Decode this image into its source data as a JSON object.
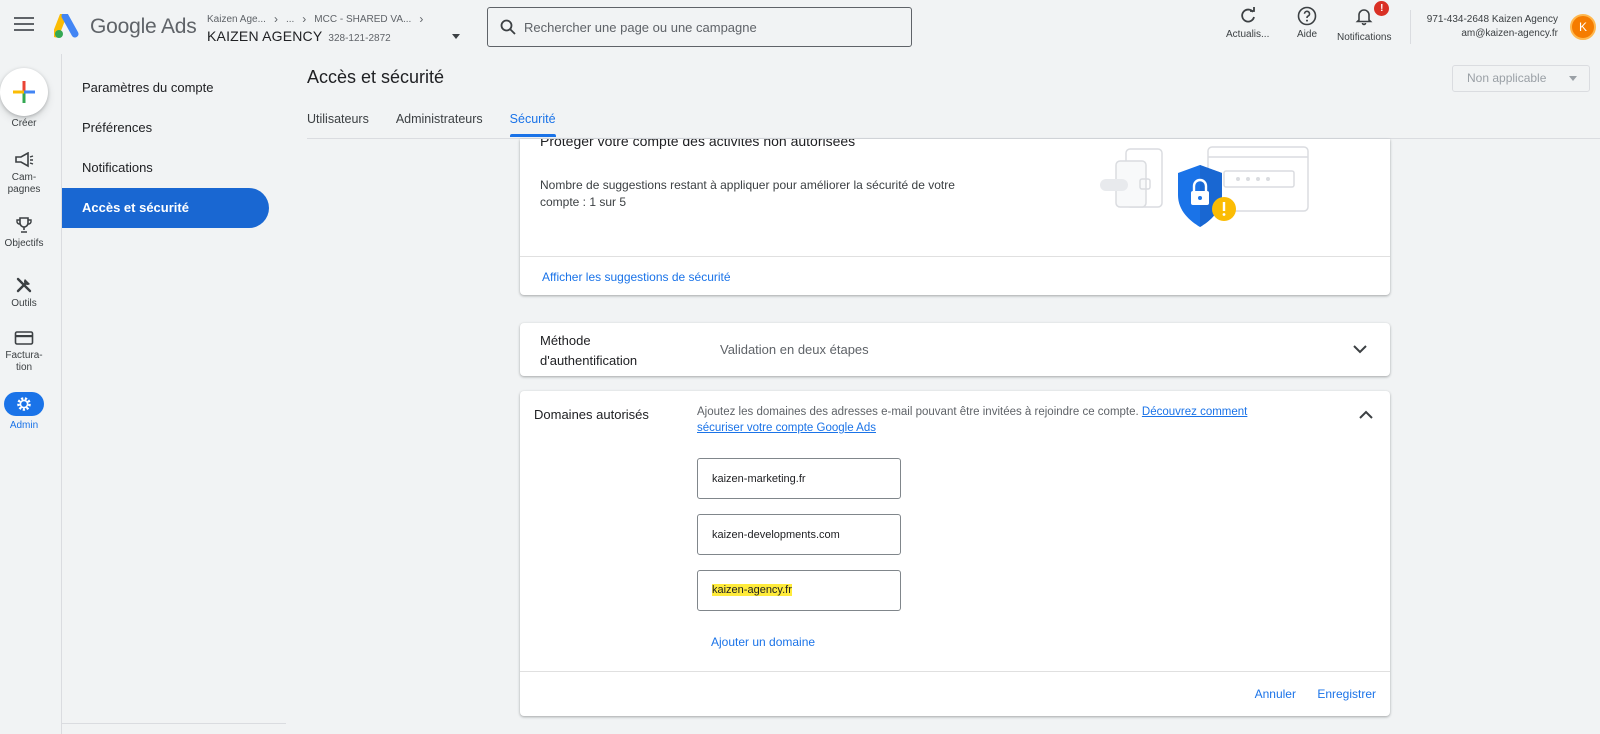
{
  "header": {
    "product_name": "Google Ads",
    "breadcrumbs": [
      "Kaizen Age...",
      "...",
      "MCC - SHARED VA..."
    ],
    "account_name": "KAIZEN AGENCY",
    "account_id": "328-121-2872",
    "search_placeholder": "Rechercher une page ou une campagne",
    "tools": {
      "refresh": "Actualis...",
      "help": "Aide",
      "notifications": "Notifications",
      "notifications_badge": "!"
    },
    "user_line1": "971-434-2648 Kaizen Agency",
    "user_line2": "am@kaizen-agency.fr",
    "avatar_letter": "K"
  },
  "rail": {
    "create": "Créer",
    "campaigns": "Cam-\npagnes",
    "goals": "Objectifs",
    "tools": "Outils",
    "billing": "Factura-\ntion",
    "admin": "Admin"
  },
  "subnav": {
    "items": [
      {
        "label": "Paramètres du compte"
      },
      {
        "label": "Préférences"
      },
      {
        "label": "Notifications"
      },
      {
        "label": "Accès et sécurité"
      }
    ],
    "active_index": 3
  },
  "page": {
    "title": "Accès et sécurité",
    "status_select": "Non applicable",
    "tabs": [
      {
        "label": "Utilisateurs"
      },
      {
        "label": "Administrateurs"
      },
      {
        "label": "Sécurité"
      }
    ],
    "active_tab": 2
  },
  "security_card": {
    "title": "Protéger votre compte des activités non autorisées",
    "description": "Nombre de suggestions restant à appliquer pour améliorer la sécurité de votre compte : 1 sur 5",
    "link": "Afficher les suggestions de sécurité"
  },
  "auth_card": {
    "label": "Méthode d'authentification",
    "value": "Validation en deux étapes"
  },
  "domains_card": {
    "label": "Domaines autorisés",
    "description": "Ajoutez les domaines des adresses e-mail pouvant être invitées à rejoindre ce compte. ",
    "description_link": "Découvrez comment sécuriser votre compte Google Ads",
    "domains": [
      "kaizen-marketing.fr",
      "kaizen-developments.com",
      "kaizen-agency.fr"
    ],
    "add_domain": "Ajouter un domaine",
    "cancel": "Annuler",
    "save": "Enregistrer"
  },
  "colors": {
    "accent": "#1a73e8",
    "active_nav": "#1967d2",
    "highlight": "#ffeb3b",
    "notif_badge": "#d93025"
  }
}
